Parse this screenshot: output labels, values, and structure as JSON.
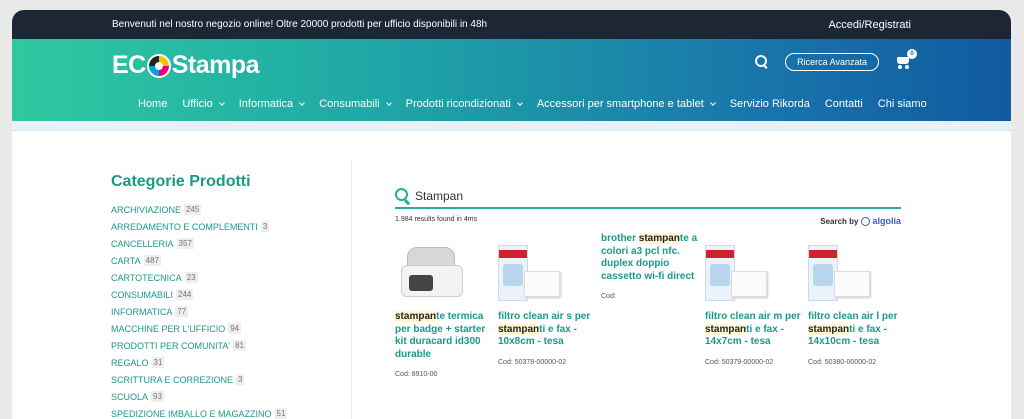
{
  "topbar": {
    "welcome": "Benvenuti nel nostro negozio online! Oltre 20000 prodotti per ufficio disponibili in 48h",
    "login": "Accedi/Registrati"
  },
  "header": {
    "logo_left": "EC",
    "logo_right": "Stampa",
    "advanced_search": "Ricerca Avanzata",
    "cart_count": "0",
    "colors": {
      "gradient_start": "#2fc9a0",
      "gradient_end": "#105a9e",
      "accent": "#1a9a86"
    }
  },
  "nav": {
    "items": [
      {
        "label": "Home"
      },
      {
        "label": "Ufficio"
      },
      {
        "label": "Informatica"
      },
      {
        "label": "Consumabili"
      },
      {
        "label": "Prodotti ricondizionati"
      },
      {
        "label": "Accessori per smartphone e tablet"
      },
      {
        "label": "Servizio Rikorda"
      },
      {
        "label": "Contatti"
      },
      {
        "label": "Chi siamo"
      }
    ]
  },
  "sidebar": {
    "title": "Categorie Prodotti",
    "categories": [
      {
        "name": "ARCHIVIAZIONE",
        "count": "245"
      },
      {
        "name": "ARREDAMENTO E COMPLEMENTI",
        "count": "3"
      },
      {
        "name": "CANCELLERIA",
        "count": "357"
      },
      {
        "name": "CARTA",
        "count": "487"
      },
      {
        "name": "CARTOTECNICA",
        "count": "23"
      },
      {
        "name": "CONSUMABILI",
        "count": "244"
      },
      {
        "name": "INFORMATICA",
        "count": "77"
      },
      {
        "name": "MACCHINE PER L'UFFICIO",
        "count": "94"
      },
      {
        "name": "PRODOTTI PER COMUNITA'",
        "count": "81"
      },
      {
        "name": "REGALO",
        "count": "31"
      },
      {
        "name": "SCRITTURA E CORREZIONE",
        "count": "3"
      },
      {
        "name": "SCUOLA",
        "count": "93"
      },
      {
        "name": "SPEDIZIONE IMBALLO E MAGAZZINO",
        "count": "51"
      }
    ]
  },
  "search": {
    "query": "Stampan",
    "results_text": "1.984 results found in 4ms",
    "search_by": "Search by",
    "provider": "algolia"
  },
  "products": [
    {
      "pre": "",
      "hl": "stampan",
      "post": "te termica per badge + starter kit duracard id300 durable",
      "cod": "Cod: 8910-00",
      "image": "printer-image"
    },
    {
      "pre": "filtro clean air s per ",
      "hl": "stampan",
      "post": "ti e fax - 10x8cm - tesa",
      "cod": "Cod: 50378-00000-02",
      "image": "filter-image"
    },
    {
      "pre": "brother ",
      "hl": "stampan",
      "post": "te a colori a3 pcl nfc. duplex doppio cassetto wi-fi direct",
      "cod": "Cod:",
      "image": ""
    },
    {
      "pre": "filtro clean air m per ",
      "hl": "stampan",
      "post": "ti e fax - 14x7cm - tesa",
      "cod": "Cod: 50379-00000-02",
      "image": "filter-image"
    },
    {
      "pre": "filtro clean air l per ",
      "hl": "stampan",
      "post": "ti e fax - 14x10cm - tesa",
      "cod": "Cod: 50380-00000-02",
      "image": "filter-image"
    }
  ]
}
